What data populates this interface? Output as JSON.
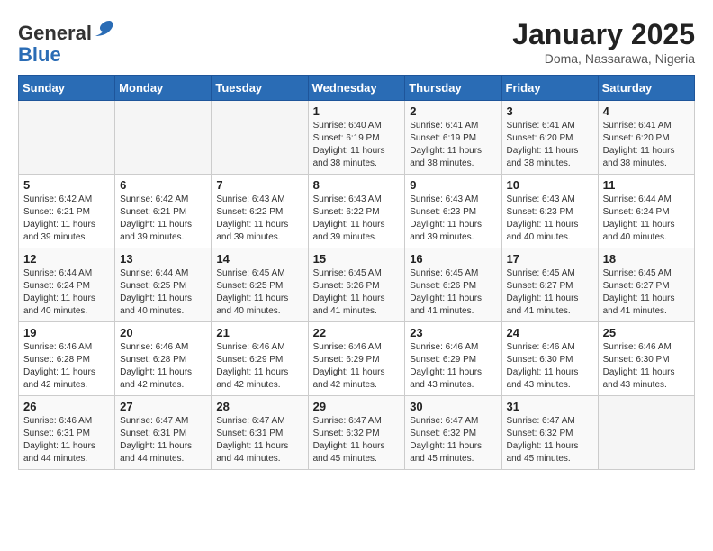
{
  "header": {
    "logo_general": "General",
    "logo_blue": "Blue",
    "month_title": "January 2025",
    "location": "Doma, Nassarawa, Nigeria"
  },
  "weekdays": [
    "Sunday",
    "Monday",
    "Tuesday",
    "Wednesday",
    "Thursday",
    "Friday",
    "Saturday"
  ],
  "weeks": [
    [
      {
        "day": "",
        "sunrise": "",
        "sunset": "",
        "daylight": ""
      },
      {
        "day": "",
        "sunrise": "",
        "sunset": "",
        "daylight": ""
      },
      {
        "day": "",
        "sunrise": "",
        "sunset": "",
        "daylight": ""
      },
      {
        "day": "1",
        "sunrise": "Sunrise: 6:40 AM",
        "sunset": "Sunset: 6:19 PM",
        "daylight": "Daylight: 11 hours and 38 minutes."
      },
      {
        "day": "2",
        "sunrise": "Sunrise: 6:41 AM",
        "sunset": "Sunset: 6:19 PM",
        "daylight": "Daylight: 11 hours and 38 minutes."
      },
      {
        "day": "3",
        "sunrise": "Sunrise: 6:41 AM",
        "sunset": "Sunset: 6:20 PM",
        "daylight": "Daylight: 11 hours and 38 minutes."
      },
      {
        "day": "4",
        "sunrise": "Sunrise: 6:41 AM",
        "sunset": "Sunset: 6:20 PM",
        "daylight": "Daylight: 11 hours and 38 minutes."
      }
    ],
    [
      {
        "day": "5",
        "sunrise": "Sunrise: 6:42 AM",
        "sunset": "Sunset: 6:21 PM",
        "daylight": "Daylight: 11 hours and 39 minutes."
      },
      {
        "day": "6",
        "sunrise": "Sunrise: 6:42 AM",
        "sunset": "Sunset: 6:21 PM",
        "daylight": "Daylight: 11 hours and 39 minutes."
      },
      {
        "day": "7",
        "sunrise": "Sunrise: 6:43 AM",
        "sunset": "Sunset: 6:22 PM",
        "daylight": "Daylight: 11 hours and 39 minutes."
      },
      {
        "day": "8",
        "sunrise": "Sunrise: 6:43 AM",
        "sunset": "Sunset: 6:22 PM",
        "daylight": "Daylight: 11 hours and 39 minutes."
      },
      {
        "day": "9",
        "sunrise": "Sunrise: 6:43 AM",
        "sunset": "Sunset: 6:23 PM",
        "daylight": "Daylight: 11 hours and 39 minutes."
      },
      {
        "day": "10",
        "sunrise": "Sunrise: 6:43 AM",
        "sunset": "Sunset: 6:23 PM",
        "daylight": "Daylight: 11 hours and 40 minutes."
      },
      {
        "day": "11",
        "sunrise": "Sunrise: 6:44 AM",
        "sunset": "Sunset: 6:24 PM",
        "daylight": "Daylight: 11 hours and 40 minutes."
      }
    ],
    [
      {
        "day": "12",
        "sunrise": "Sunrise: 6:44 AM",
        "sunset": "Sunset: 6:24 PM",
        "daylight": "Daylight: 11 hours and 40 minutes."
      },
      {
        "day": "13",
        "sunrise": "Sunrise: 6:44 AM",
        "sunset": "Sunset: 6:25 PM",
        "daylight": "Daylight: 11 hours and 40 minutes."
      },
      {
        "day": "14",
        "sunrise": "Sunrise: 6:45 AM",
        "sunset": "Sunset: 6:25 PM",
        "daylight": "Daylight: 11 hours and 40 minutes."
      },
      {
        "day": "15",
        "sunrise": "Sunrise: 6:45 AM",
        "sunset": "Sunset: 6:26 PM",
        "daylight": "Daylight: 11 hours and 41 minutes."
      },
      {
        "day": "16",
        "sunrise": "Sunrise: 6:45 AM",
        "sunset": "Sunset: 6:26 PM",
        "daylight": "Daylight: 11 hours and 41 minutes."
      },
      {
        "day": "17",
        "sunrise": "Sunrise: 6:45 AM",
        "sunset": "Sunset: 6:27 PM",
        "daylight": "Daylight: 11 hours and 41 minutes."
      },
      {
        "day": "18",
        "sunrise": "Sunrise: 6:45 AM",
        "sunset": "Sunset: 6:27 PM",
        "daylight": "Daylight: 11 hours and 41 minutes."
      }
    ],
    [
      {
        "day": "19",
        "sunrise": "Sunrise: 6:46 AM",
        "sunset": "Sunset: 6:28 PM",
        "daylight": "Daylight: 11 hours and 42 minutes."
      },
      {
        "day": "20",
        "sunrise": "Sunrise: 6:46 AM",
        "sunset": "Sunset: 6:28 PM",
        "daylight": "Daylight: 11 hours and 42 minutes."
      },
      {
        "day": "21",
        "sunrise": "Sunrise: 6:46 AM",
        "sunset": "Sunset: 6:29 PM",
        "daylight": "Daylight: 11 hours and 42 minutes."
      },
      {
        "day": "22",
        "sunrise": "Sunrise: 6:46 AM",
        "sunset": "Sunset: 6:29 PM",
        "daylight": "Daylight: 11 hours and 42 minutes."
      },
      {
        "day": "23",
        "sunrise": "Sunrise: 6:46 AM",
        "sunset": "Sunset: 6:29 PM",
        "daylight": "Daylight: 11 hours and 43 minutes."
      },
      {
        "day": "24",
        "sunrise": "Sunrise: 6:46 AM",
        "sunset": "Sunset: 6:30 PM",
        "daylight": "Daylight: 11 hours and 43 minutes."
      },
      {
        "day": "25",
        "sunrise": "Sunrise: 6:46 AM",
        "sunset": "Sunset: 6:30 PM",
        "daylight": "Daylight: 11 hours and 43 minutes."
      }
    ],
    [
      {
        "day": "26",
        "sunrise": "Sunrise: 6:46 AM",
        "sunset": "Sunset: 6:31 PM",
        "daylight": "Daylight: 11 hours and 44 minutes."
      },
      {
        "day": "27",
        "sunrise": "Sunrise: 6:47 AM",
        "sunset": "Sunset: 6:31 PM",
        "daylight": "Daylight: 11 hours and 44 minutes."
      },
      {
        "day": "28",
        "sunrise": "Sunrise: 6:47 AM",
        "sunset": "Sunset: 6:31 PM",
        "daylight": "Daylight: 11 hours and 44 minutes."
      },
      {
        "day": "29",
        "sunrise": "Sunrise: 6:47 AM",
        "sunset": "Sunset: 6:32 PM",
        "daylight": "Daylight: 11 hours and 45 minutes."
      },
      {
        "day": "30",
        "sunrise": "Sunrise: 6:47 AM",
        "sunset": "Sunset: 6:32 PM",
        "daylight": "Daylight: 11 hours and 45 minutes."
      },
      {
        "day": "31",
        "sunrise": "Sunrise: 6:47 AM",
        "sunset": "Sunset: 6:32 PM",
        "daylight": "Daylight: 11 hours and 45 minutes."
      },
      {
        "day": "",
        "sunrise": "",
        "sunset": "",
        "daylight": ""
      }
    ]
  ]
}
